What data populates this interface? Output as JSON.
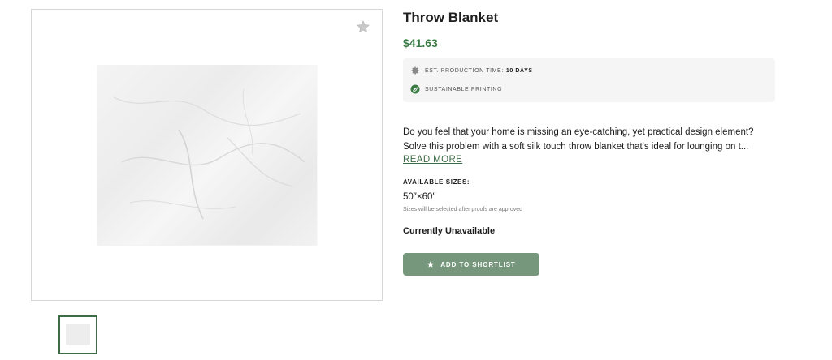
{
  "product": {
    "title": "Throw Blanket",
    "price": "$41.63",
    "favorite_icon": "star-icon"
  },
  "features": [
    {
      "icon": "gear-icon",
      "label": "EST. PRODUCTION TIME:",
      "value": "10 DAYS"
    },
    {
      "icon": "leaf-icon",
      "label": "SUSTAINABLE PRINTING",
      "value": ""
    }
  ],
  "description": {
    "line1": "Do you feel that your home is missing an eye-catching, yet practical design element?",
    "line2": "Solve this problem with a soft silk touch throw blanket that's ideal for lounging on t...",
    "read_more": "READ MORE"
  },
  "sizes": {
    "label": "AVAILABLE SIZES:",
    "value": "50″×60″",
    "note": "Sizes will be selected after proofs are approved"
  },
  "availability": "Currently Unavailable",
  "shortlist_button": {
    "label": "ADD TO SHORTLIST",
    "icon": "star-icon"
  },
  "colors": {
    "accent_green": "#3d6b45",
    "price_green": "#3a7a44",
    "button_bg": "#76977b"
  }
}
